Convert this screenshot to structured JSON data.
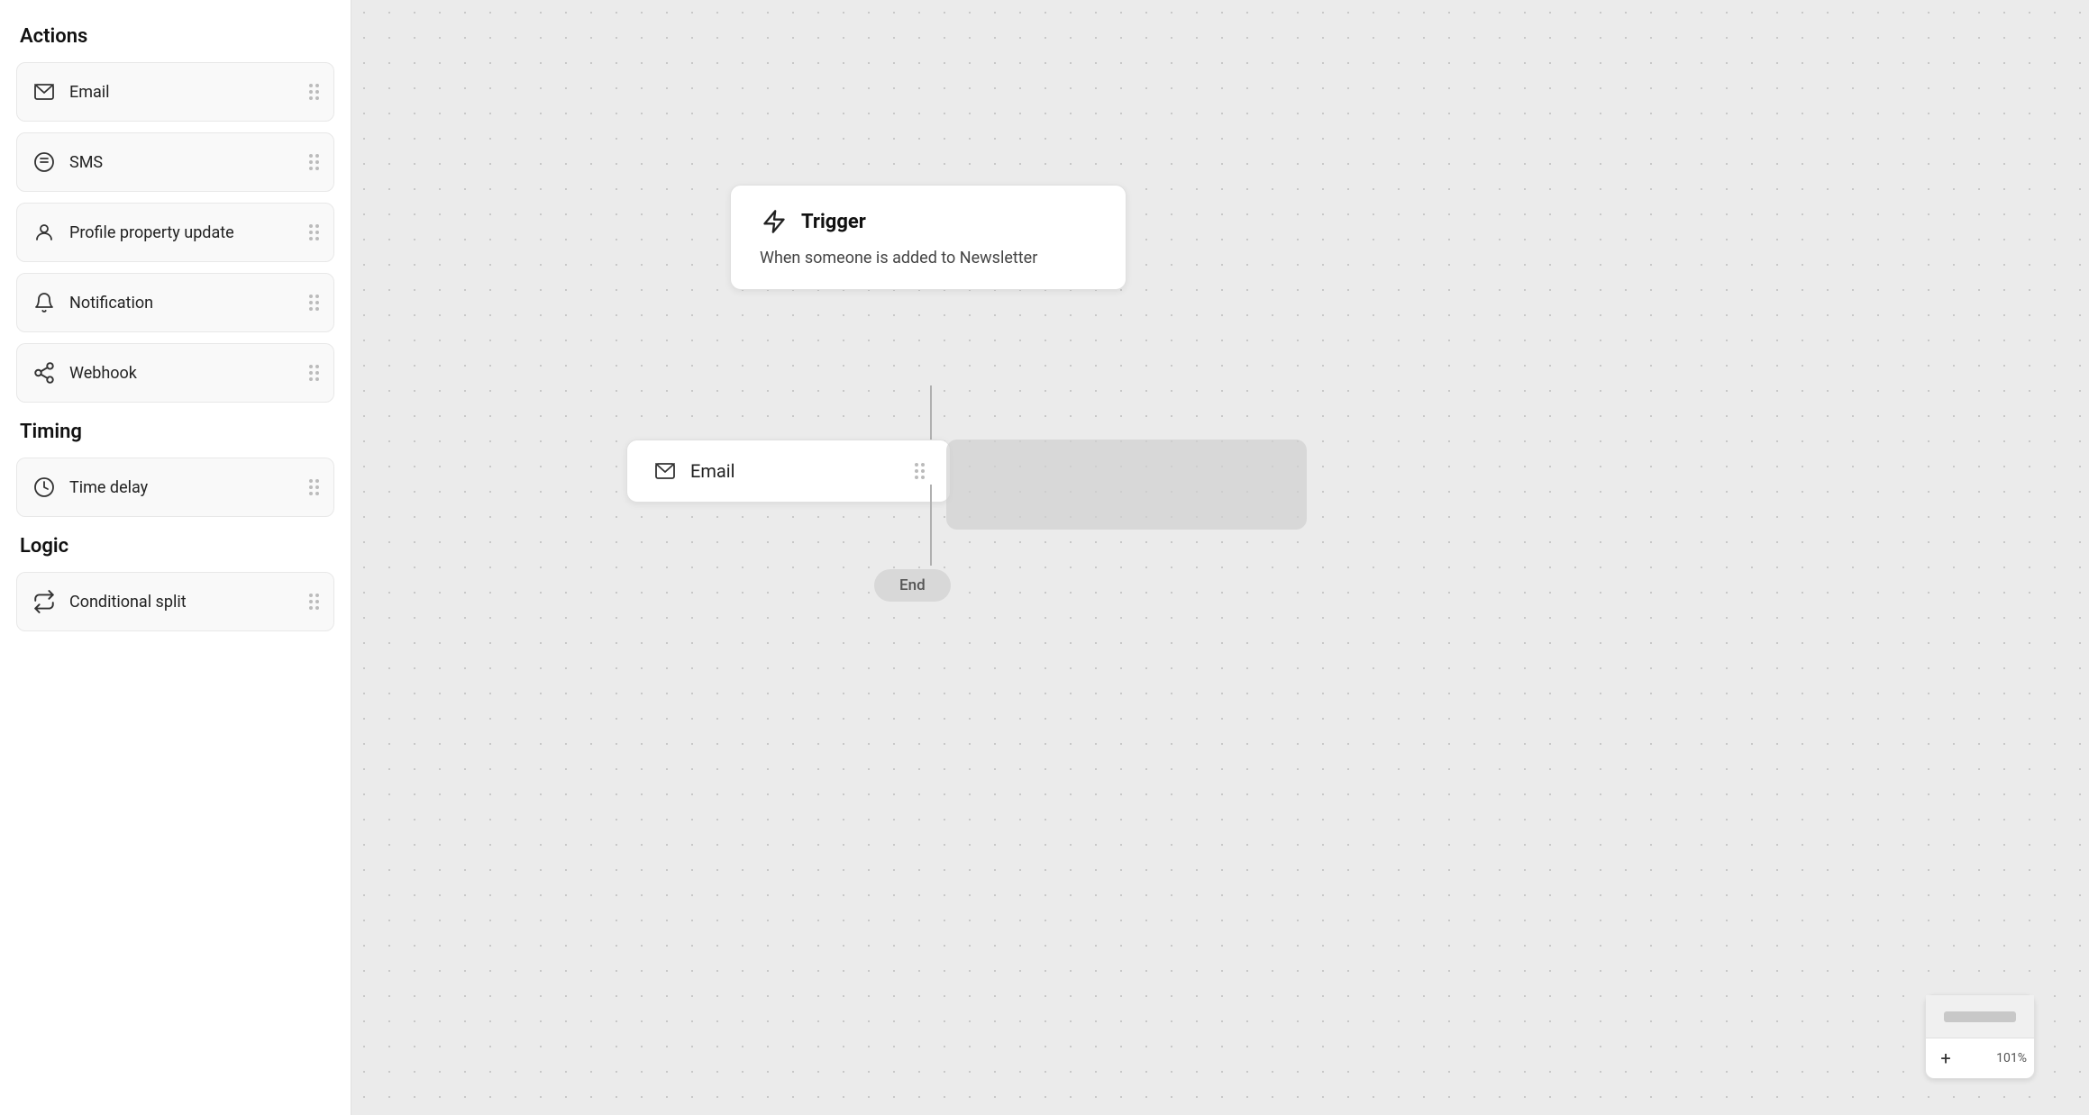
{
  "sidebar": {
    "actions_title": "Actions",
    "timing_title": "Timing",
    "logic_title": "Logic",
    "items": [
      {
        "id": "email",
        "label": "Email",
        "icon": "mail-icon"
      },
      {
        "id": "sms",
        "label": "SMS",
        "icon": "sms-icon"
      },
      {
        "id": "profile-property-update",
        "label": "Profile property update",
        "icon": "person-icon"
      },
      {
        "id": "notification",
        "label": "Notification",
        "icon": "bell-icon"
      },
      {
        "id": "webhook",
        "label": "Webhook",
        "icon": "webhook-icon"
      }
    ],
    "timing_items": [
      {
        "id": "time-delay",
        "label": "Time delay",
        "icon": "clock-icon"
      }
    ],
    "logic_items": [
      {
        "id": "conditional-split",
        "label": "Conditional split",
        "icon": "split-icon"
      }
    ]
  },
  "canvas": {
    "trigger_node": {
      "title": "Trigger",
      "description": "When someone is added to Newsletter"
    },
    "email_node": {
      "label": "Email"
    },
    "end_node": {
      "label": "End"
    },
    "zoom_level": "101%",
    "zoom_plus": "+",
    "zoom_minus": "−"
  }
}
